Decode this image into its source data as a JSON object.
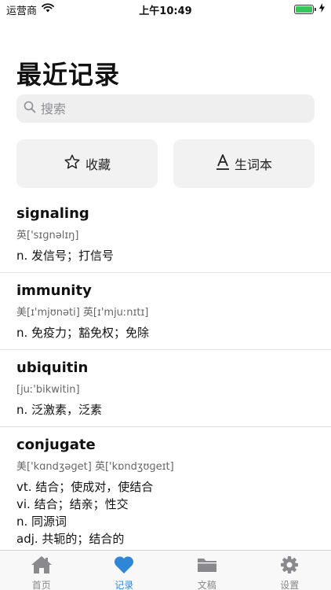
{
  "status": {
    "carrier": "运营商",
    "time": "上午10:49"
  },
  "page": {
    "title": "最近记录"
  },
  "search": {
    "placeholder": "搜索"
  },
  "quick": {
    "favorites": "收藏",
    "vocabulary": "生词本"
  },
  "history": [
    {
      "word": "signaling",
      "phonetic": "英['sɪɡnəlɪŋ]",
      "defs": [
        "n. 发信号；打信号"
      ]
    },
    {
      "word": "immunity",
      "phonetic": "美[ɪ'mjʊnəti] 英[ɪ'mjuːnɪtɪ]",
      "defs": [
        "n. 免疫力；豁免权；免除"
      ]
    },
    {
      "word": "ubiquitin",
      "phonetic": "[juː'bikwitin]",
      "defs": [
        "n. 泛激素，泛素"
      ]
    },
    {
      "word": "conjugate",
      "phonetic": "美['kɑndʒəɡet] 英['kɒndʒʊɡeɪt]",
      "defs": [
        "vt. 结合；使成对，使结合",
        "vi. 结合；结亲；性交",
        "n. 同源词",
        "adj. 共轭的；结合的"
      ]
    }
  ],
  "tabs": [
    {
      "label": "首页",
      "icon": "home-icon"
    },
    {
      "label": "记录",
      "icon": "heart-icon",
      "active": true
    },
    {
      "label": "文稿",
      "icon": "folder-icon"
    },
    {
      "label": "设置",
      "icon": "gear-icon"
    }
  ],
  "colors": {
    "accent": "#2f86d6",
    "battery": "#34c759"
  }
}
